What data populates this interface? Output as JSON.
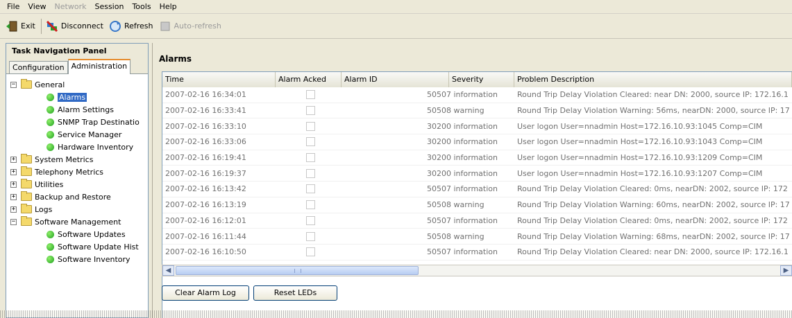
{
  "menu": {
    "items": [
      {
        "label": "File",
        "enabled": true
      },
      {
        "label": "View",
        "enabled": true
      },
      {
        "label": "Network",
        "enabled": false
      },
      {
        "label": "Session",
        "enabled": true
      },
      {
        "label": "Tools",
        "enabled": true
      },
      {
        "label": "Help",
        "enabled": true
      }
    ]
  },
  "toolbar": {
    "exit_label": "Exit",
    "disconnect_label": "Disconnect",
    "refresh_label": "Refresh",
    "autorefresh_label": "Auto-refresh"
  },
  "nav": {
    "title": "Task Navigation Panel",
    "tabs": {
      "configuration": "Configuration",
      "administration": "Administration"
    },
    "tree": {
      "general": "General",
      "general_items": [
        "Alarms",
        "Alarm Settings",
        "SNMP Trap Destinatio",
        "Service Manager",
        "Hardware Inventory"
      ],
      "system_metrics": "System Metrics",
      "telephony_metrics": "Telephony Metrics",
      "utilities": "Utilities",
      "backup_restore": "Backup and Restore",
      "logs": "Logs",
      "software_management": "Software Management",
      "software_items": [
        "Software Updates",
        "Software Update Hist",
        "Software Inventory"
      ]
    }
  },
  "alarms": {
    "title": "Alarms",
    "columns": {
      "time": "Time",
      "acked": "Alarm Acked",
      "id": "Alarm ID",
      "severity": "Severity",
      "desc": "Problem Description"
    },
    "rows": [
      {
        "time": "2007-02-16 16:34:01",
        "id": "50507",
        "severity": "information",
        "desc": "Round Trip Delay Violation Cleared: near DN: 2000, source IP: 172.16.1"
      },
      {
        "time": "2007-02-16 16:33:41",
        "id": "50508",
        "severity": "warning",
        "desc": "Round Trip Delay Violation Warning: 56ms, nearDN: 2000, source IP: 17"
      },
      {
        "time": "2007-02-16 16:33:10",
        "id": "30200",
        "severity": "information",
        "desc": "User logon  User=nnadmin Host=172.16.10.93:1045 Comp=CIM"
      },
      {
        "time": "2007-02-16 16:33:06",
        "id": "30200",
        "severity": "information",
        "desc": "User logon  User=nnadmin Host=172.16.10.93:1043 Comp=CIM"
      },
      {
        "time": "2007-02-16 16:19:41",
        "id": "30200",
        "severity": "information",
        "desc": "User logon  User=nnadmin Host=172.16.10.93:1209 Comp=CIM"
      },
      {
        "time": "2007-02-16 16:19:37",
        "id": "30200",
        "severity": "information",
        "desc": "User logon  User=nnadmin Host=172.16.10.93:1207 Comp=CIM"
      },
      {
        "time": "2007-02-16 16:13:42",
        "id": "50507",
        "severity": "information",
        "desc": "Round Trip Delay Violation Cleared: 0ms, nearDN: 2002, source IP: 172"
      },
      {
        "time": "2007-02-16 16:13:19",
        "id": "50508",
        "severity": "warning",
        "desc": "Round Trip Delay Violation Warning: 60ms, nearDN: 2002, source IP: 17"
      },
      {
        "time": "2007-02-16 16:12:01",
        "id": "50507",
        "severity": "information",
        "desc": "Round Trip Delay Violation Cleared: 0ms, nearDN: 2002, source IP: 172"
      },
      {
        "time": "2007-02-16 16:11:44",
        "id": "50508",
        "severity": "warning",
        "desc": "Round Trip Delay Violation Warning: 68ms, nearDN: 2002, source IP: 17"
      },
      {
        "time": "2007-02-16 16:10:50",
        "id": "50507",
        "severity": "information",
        "desc": "Round Trip Delay Violation Cleared: near DN: 2000, source IP: 172.16.1"
      }
    ],
    "clear_button": "Clear Alarm Log",
    "reset_button": "Reset LEDs"
  },
  "colors": {
    "selection": "#316ac5",
    "tab_accent": "#e68b2c",
    "window_bg": "#ece9d8"
  }
}
